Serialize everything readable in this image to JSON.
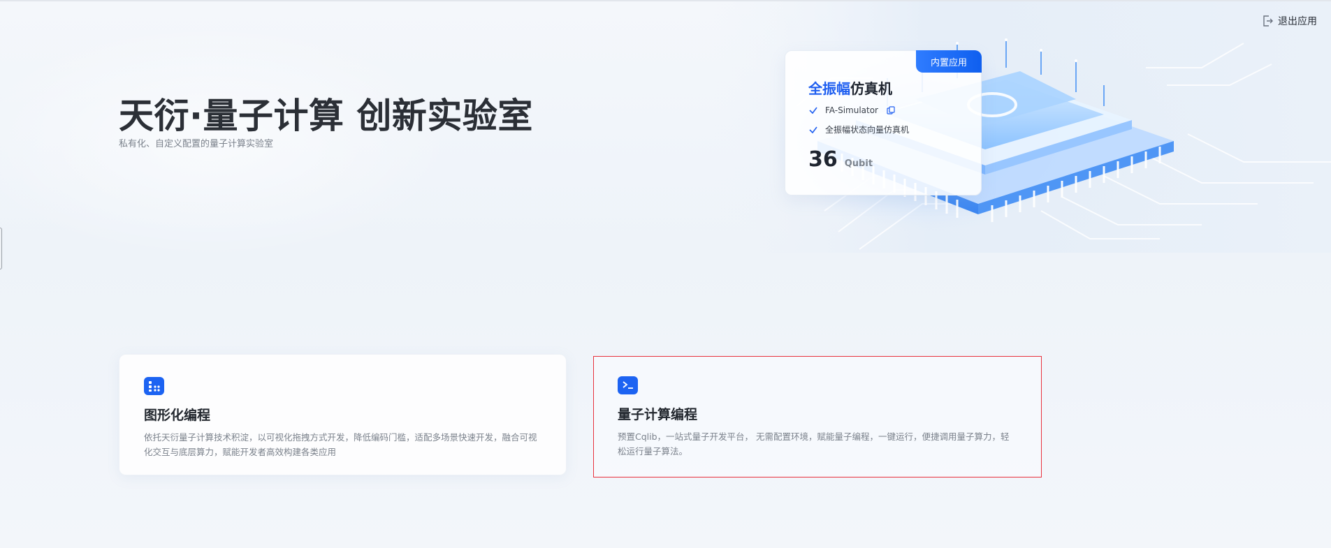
{
  "header": {
    "exit_label": "退出应用",
    "exit_icon": "logout-icon"
  },
  "hero": {
    "title": "天衍·量子计算 创新实验室",
    "subtitle": "私有化、自定义配置的量子计算实验室"
  },
  "simulator_card": {
    "badge": "内置应用",
    "title_highlight": "全振幅",
    "title_rest": "仿真机",
    "features": [
      {
        "label": "FA-Simulator",
        "icon": "check-icon",
        "action_icon": "copy-icon"
      },
      {
        "label": "全振幅状态向量仿真机",
        "icon": "check-icon"
      }
    ],
    "qubit_count": "36",
    "qubit_unit": "Qubit",
    "accent_color": "#1e5ef0"
  },
  "cards": [
    {
      "icon": "grid-blocks-icon",
      "title": "图形化编程",
      "description": "依托天衍量子计算技术积淀，以可视化拖拽方式开发，降低编码门槛，适配多场景快速开发，融合可视化交互与底层算力，赋能开发者高效构建各类应用"
    },
    {
      "icon": "terminal-icon",
      "title": "量子计算编程",
      "description": "预置Cqlib，一站式量子开发平台， 无需配置环境，赋能量子编程，一键运行，便捷调用量子算力，轻松运行量子算法。"
    }
  ]
}
